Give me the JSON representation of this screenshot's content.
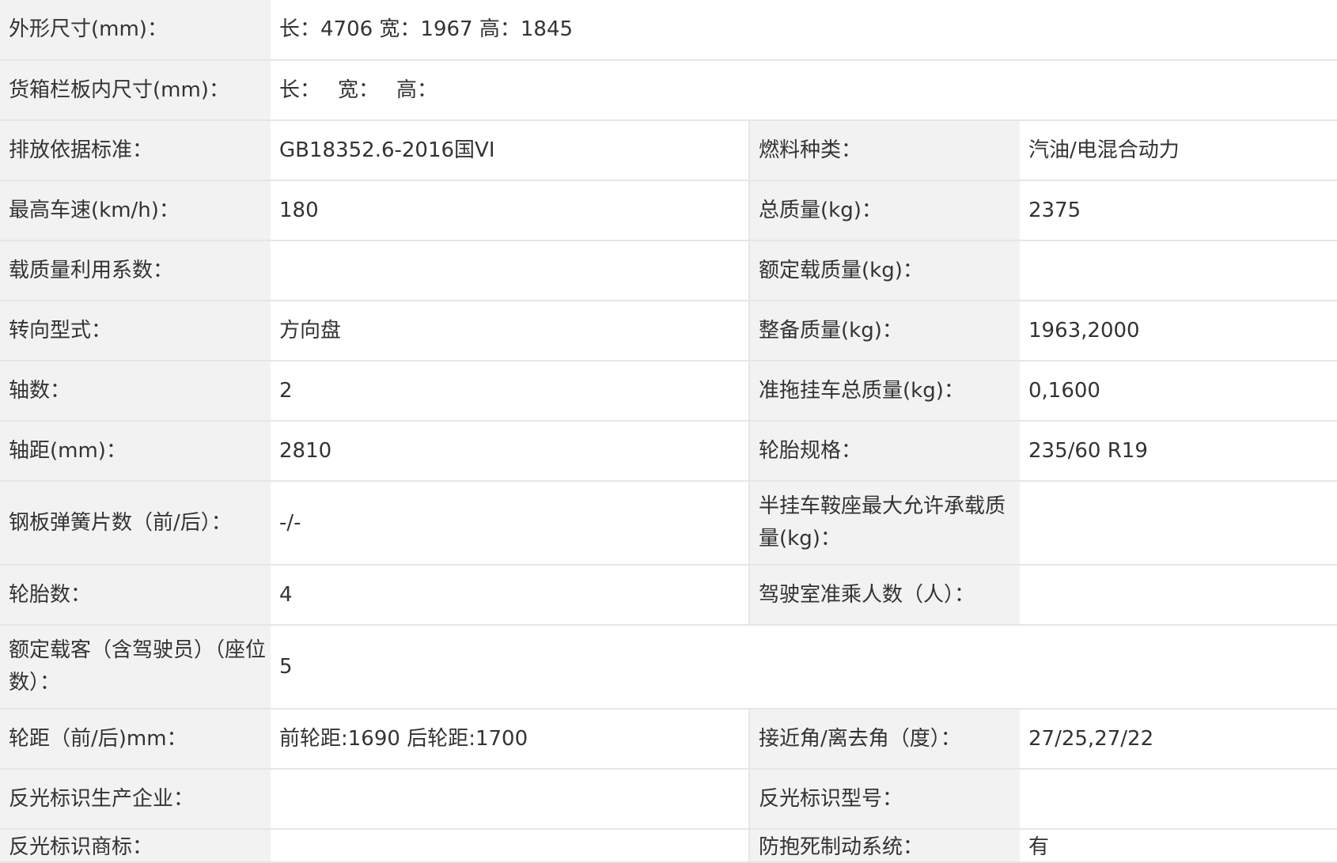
{
  "rows": [
    {
      "type": "wide",
      "label": "外形尺寸(mm)：",
      "value": "长：4706 宽：1967 高：1845"
    },
    {
      "type": "wide",
      "label": "货箱栏板内尺寸(mm)：",
      "value_parts": [
        "长：",
        "宽：",
        "高："
      ]
    },
    {
      "type": "pair",
      "label1": "排放依据标准：",
      "value1": "GB18352.6-2016国VI",
      "label2": "燃料种类：",
      "value2": "汽油/电混合动力"
    },
    {
      "type": "pair",
      "label1": "最高车速(km/h)：",
      "value1": "180",
      "label2": "总质量(kg)：",
      "value2": "2375"
    },
    {
      "type": "pair",
      "label1": "载质量利用系数：",
      "value1": "",
      "label2": "额定载质量(kg)：",
      "value2": ""
    },
    {
      "type": "pair",
      "label1": "转向型式：",
      "value1": "方向盘",
      "label2": "整备质量(kg)：",
      "value2": "1963,2000"
    },
    {
      "type": "pair",
      "label1": "轴数：",
      "value1": "2",
      "label2": "准拖挂车总质量(kg)：",
      "value2": "0,1600"
    },
    {
      "type": "pair",
      "label1": "轴距(mm)：",
      "value1": "2810",
      "label2": "轮胎规格：",
      "value2": "235/60 R19"
    },
    {
      "type": "pair",
      "label1": "钢板弹簧片数（前/后）：",
      "value1": "-/-",
      "label2": "半挂车鞍座最大允许承载质量(kg)：",
      "value2": ""
    },
    {
      "type": "pair",
      "label1": "轮胎数：",
      "value1": "4",
      "label2": "驾驶室准乘人数（人）：",
      "value2": ""
    },
    {
      "type": "wide",
      "label": "额定载客（含驾驶员）（座位数）：",
      "value": "5"
    },
    {
      "type": "pair",
      "label1": "轮距（前/后)mm：",
      "value1": "前轮距:1690 后轮距:1700",
      "label2": "接近角/离去角（度）：",
      "value2": "27/25,27/22"
    },
    {
      "type": "pair",
      "label1": "反光标识生产企业：",
      "value1": "",
      "label2": "反光标识型号：",
      "value2": ""
    },
    {
      "type": "pair",
      "label1": "反光标识商标：",
      "value1": "",
      "label2": "防抱死制动系统：",
      "value2": "有"
    }
  ]
}
